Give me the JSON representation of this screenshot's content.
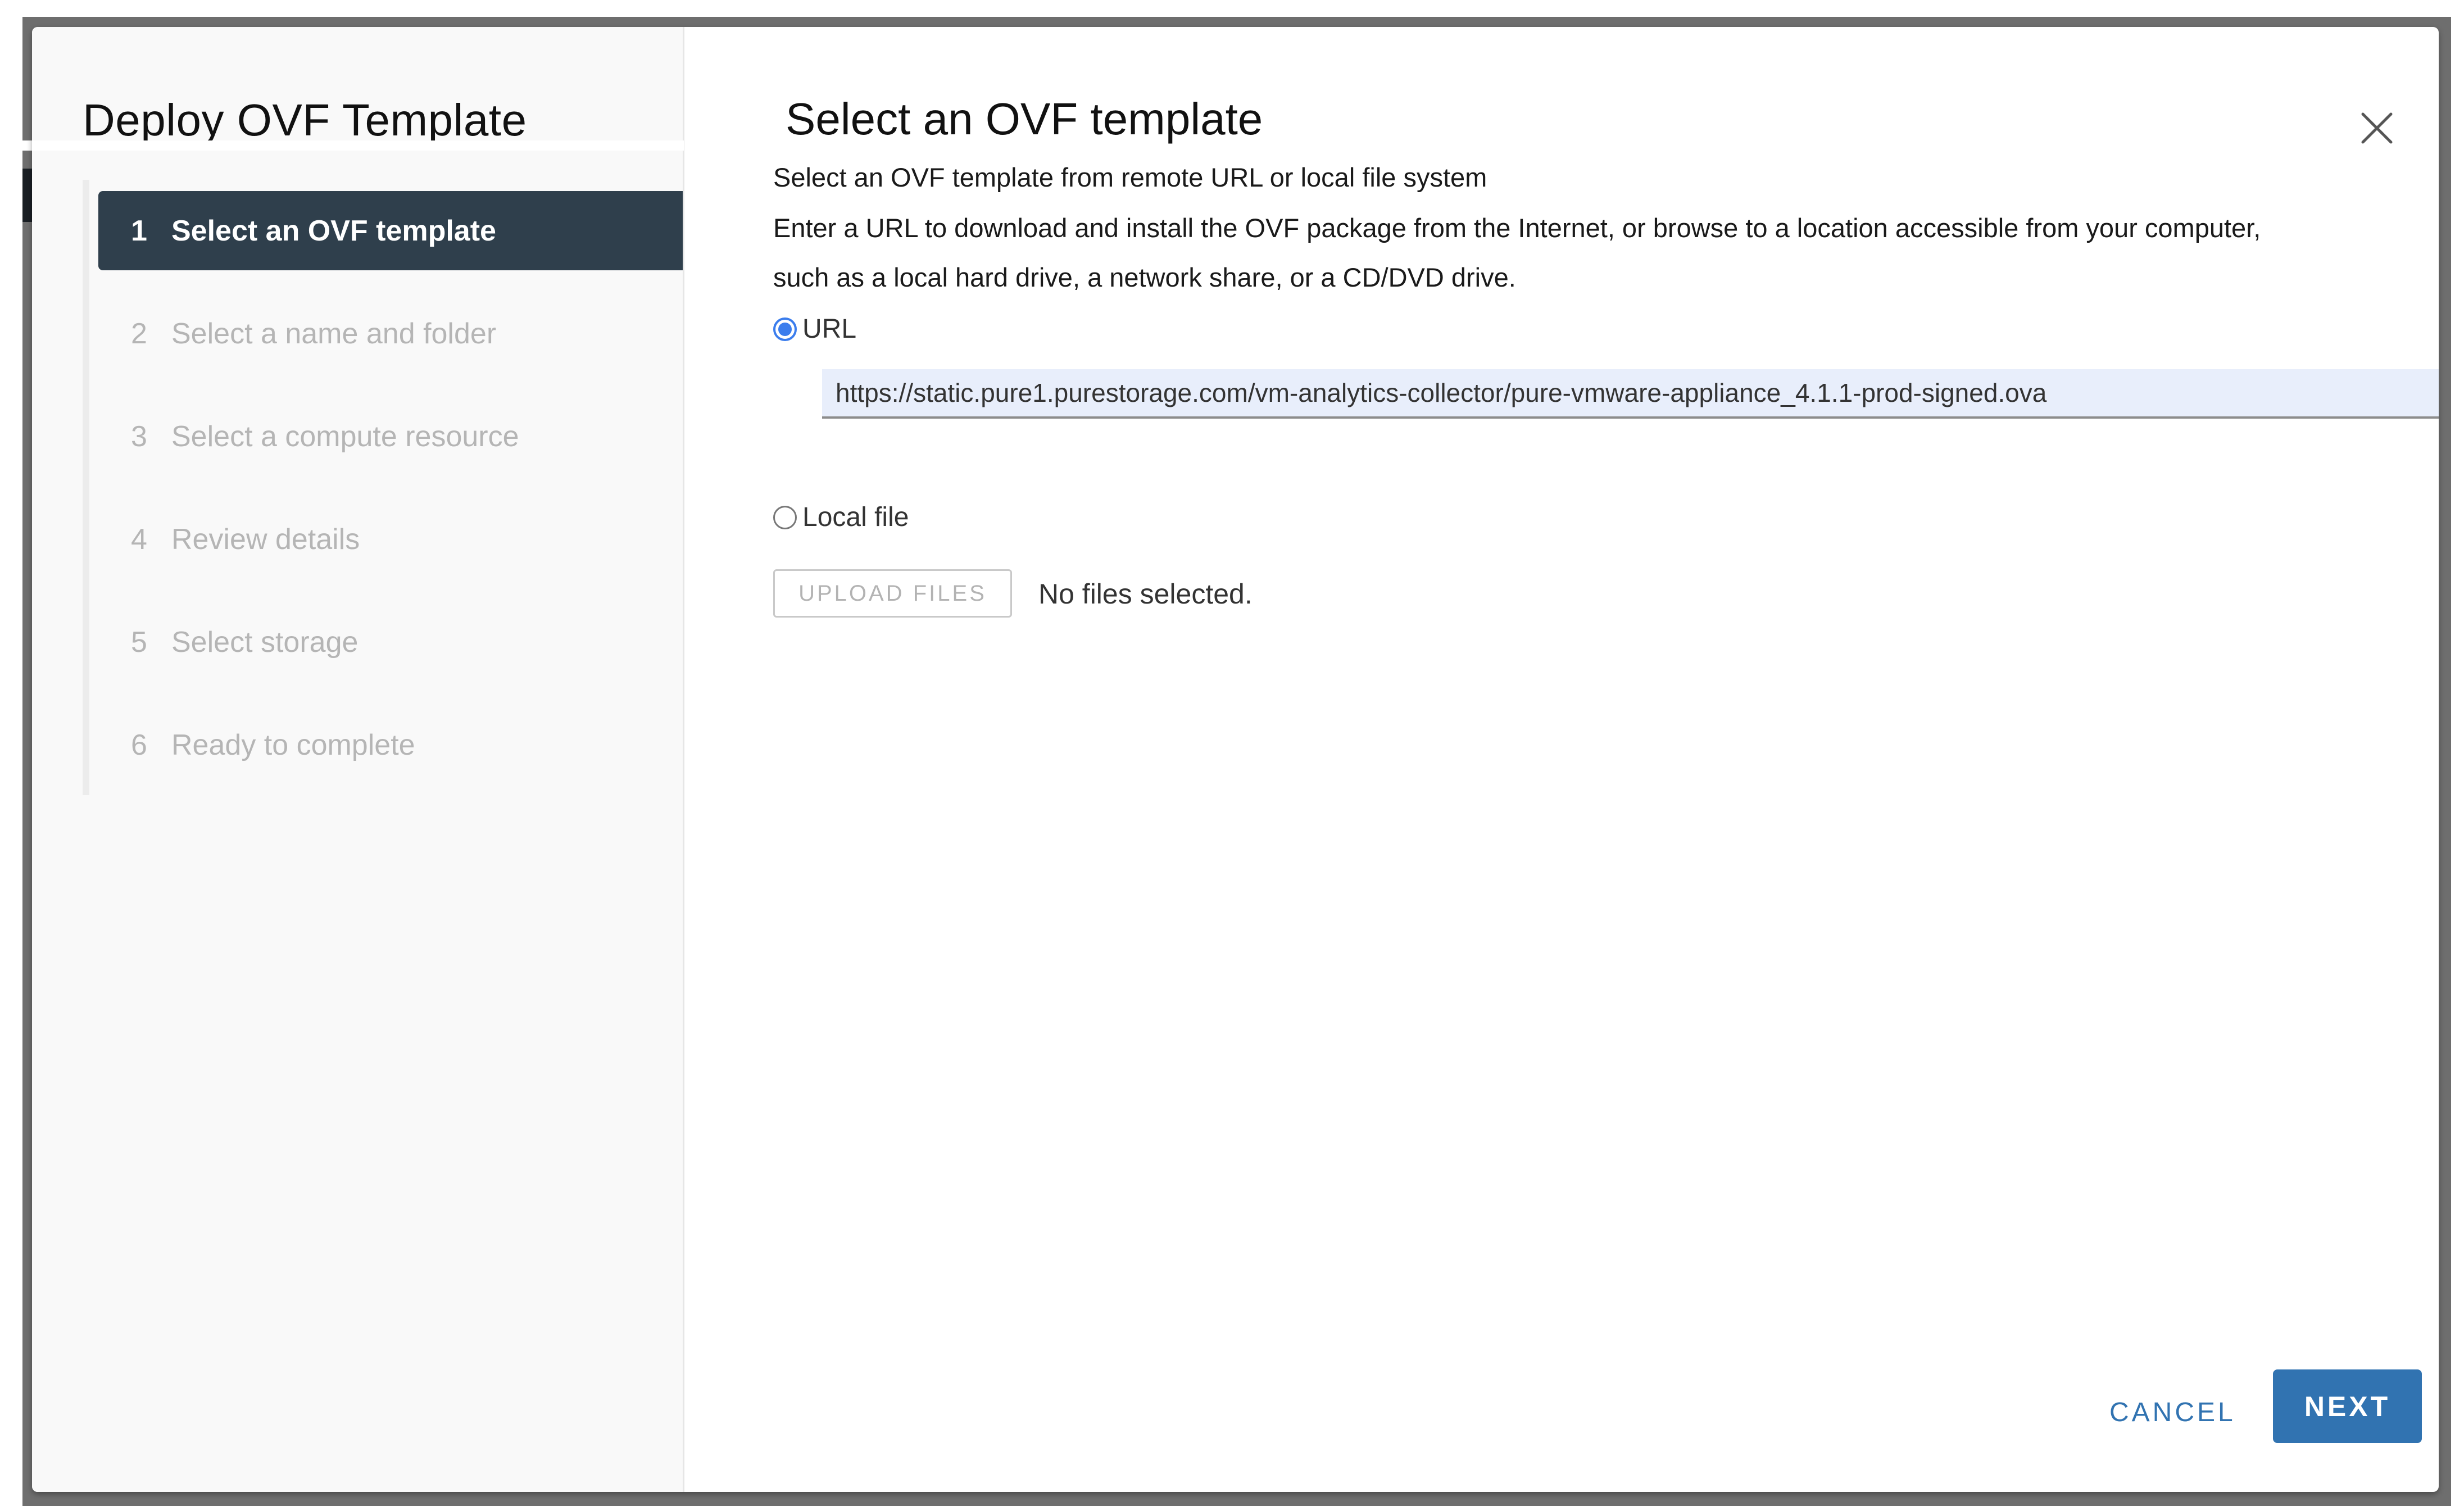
{
  "dialog": {
    "title": "Deploy OVF Template",
    "close_icon": "close-icon"
  },
  "steps": [
    {
      "number": "1",
      "label": "Select an OVF template",
      "active": true
    },
    {
      "number": "2",
      "label": "Select a name and folder",
      "active": false
    },
    {
      "number": "3",
      "label": "Select a compute resource",
      "active": false
    },
    {
      "number": "4",
      "label": "Review details",
      "active": false
    },
    {
      "number": "5",
      "label": "Select storage",
      "active": false
    },
    {
      "number": "6",
      "label": "Ready to complete",
      "active": false
    }
  ],
  "content": {
    "title": "Select an OVF template",
    "subtitle": "Select an OVF template from remote URL or local file system",
    "description_line1": "Enter a URL to download and install the OVF package from the Internet, or browse to a location accessible from your computer,",
    "description_line2": "such as a local hard drive, a network share, or a CD/DVD drive.",
    "source_options": {
      "url_label": "URL",
      "url_selected": true,
      "local_file_label": "Local file",
      "local_file_selected": false
    },
    "url_value": "https://static.pure1.purestorage.com/vm-analytics-collector/pure-vmware-appliance_4.1.1-prod-signed.ova",
    "upload_button": "UPLOAD FILES",
    "upload_status": "No files selected."
  },
  "footer": {
    "cancel_label": "CANCEL",
    "next_label": "NEXT"
  },
  "colors": {
    "active_step_bg": "#2f3f4c",
    "primary": "#3173b1",
    "radio_checked": "#3b7ded",
    "url_input_bg": "#e8eefb"
  }
}
